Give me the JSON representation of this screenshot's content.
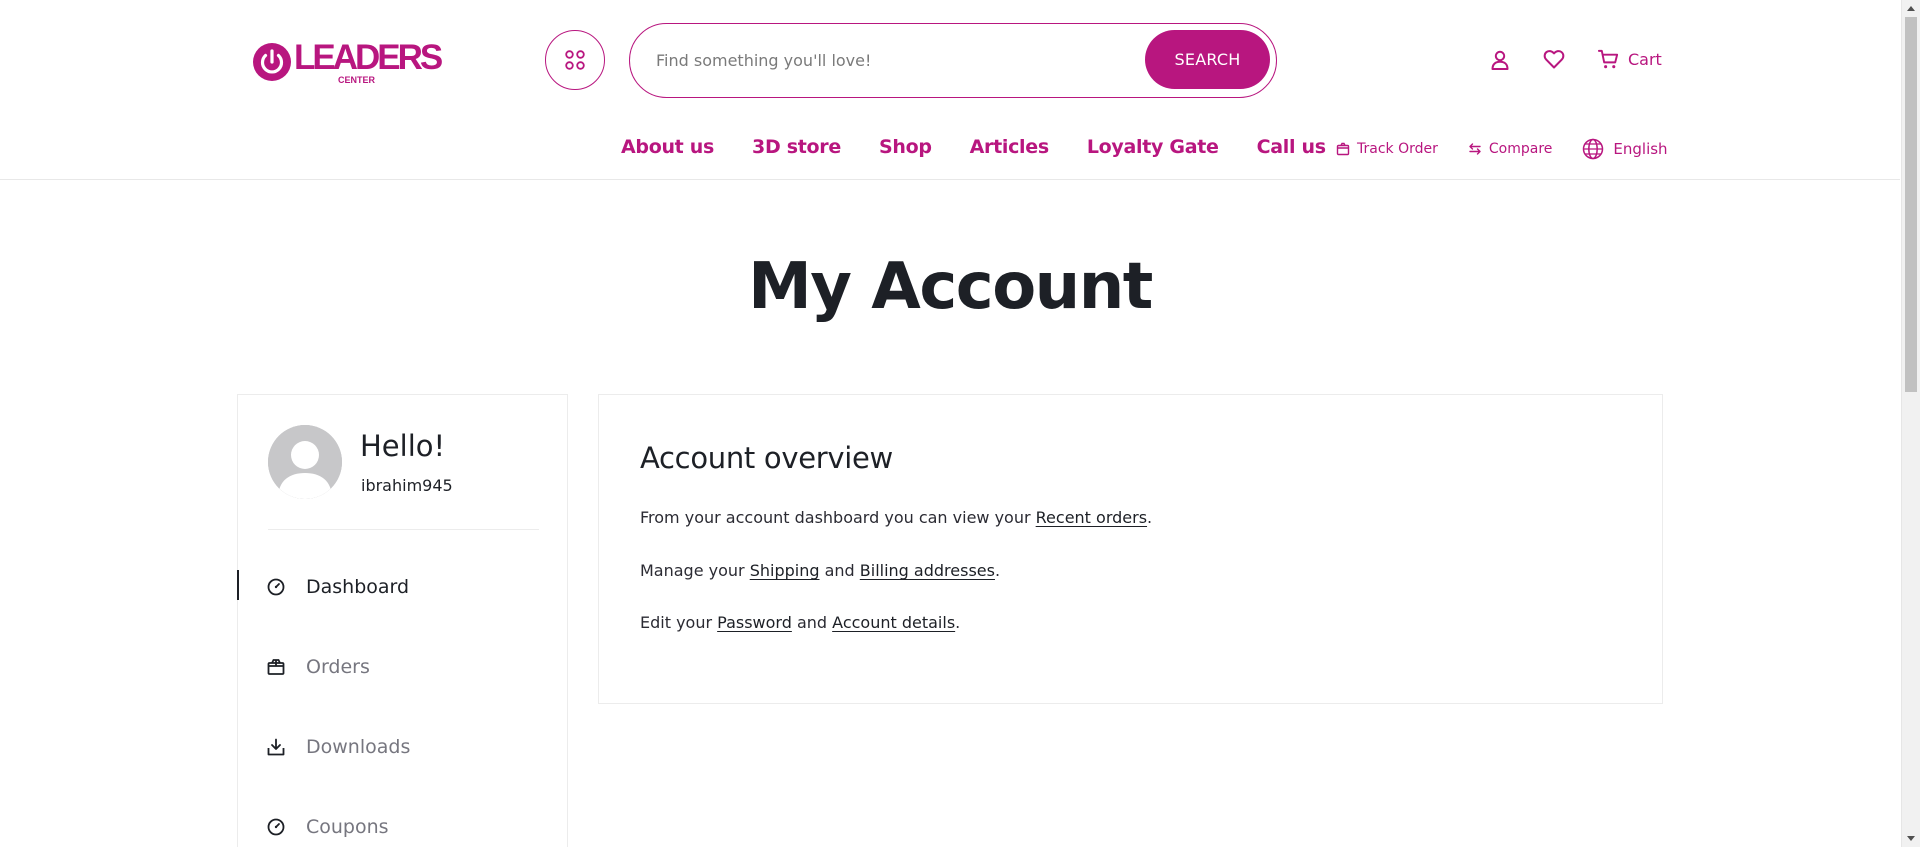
{
  "brand": {
    "logo_word": "LEADERS",
    "logo_sub": "CENTER",
    "color": "#b8167f"
  },
  "search": {
    "placeholder": "Find something you'll love!",
    "button_label": "SEARCH"
  },
  "header": {
    "cart_label": "Cart"
  },
  "icons": {
    "categories": "grid-icon",
    "account": "user-icon",
    "wishlist": "heart-icon",
    "cart": "cart-icon",
    "track": "package-icon",
    "compare": "swap-icon",
    "language": "globe-icon"
  },
  "main_nav": [
    {
      "label": "About us"
    },
    {
      "label": "3D store"
    },
    {
      "label": "Shop"
    },
    {
      "label": "Articles"
    },
    {
      "label": "Loyalty Gate"
    },
    {
      "label": "Call us"
    }
  ],
  "util_nav": {
    "track_order": "Track Order",
    "compare": "Compare",
    "language": "English"
  },
  "page": {
    "title": "My Account"
  },
  "sidebar": {
    "greeting": "Hello!",
    "username": "ibrahim945",
    "items": [
      {
        "label": "Dashboard",
        "icon": "gauge-icon",
        "active": true
      },
      {
        "label": "Orders",
        "icon": "box-icon",
        "active": false
      },
      {
        "label": "Downloads",
        "icon": "download-icon",
        "active": false
      },
      {
        "label": "Coupons",
        "icon": "gauge-icon",
        "active": false
      }
    ]
  },
  "overview": {
    "title": "Account overview",
    "line1_prefix": "From your account dashboard you can view your ",
    "line1_link": "Recent orders",
    "line1_suffix": ".",
    "line2_prefix": "Manage your ",
    "line2_link1": "Shipping",
    "line2_mid": " and ",
    "line2_link2": "Billing addresses",
    "line2_suffix": ".",
    "line3_prefix": "Edit your ",
    "line3_link1": "Password",
    "line3_mid": " and ",
    "line3_link2": "Account details",
    "line3_suffix": "."
  }
}
